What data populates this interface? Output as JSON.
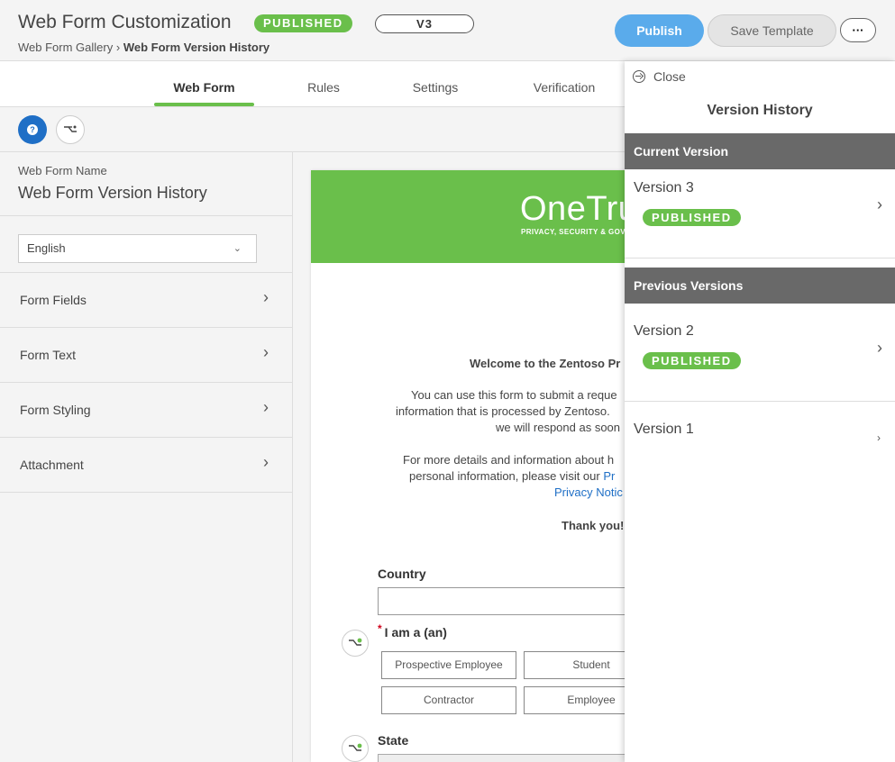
{
  "header": {
    "title": "Web Form Customization",
    "status_badge": "PUBLISHED",
    "version": "V3",
    "breadcrumb_parent": "Web Form Gallery",
    "breadcrumb_sep": "›",
    "breadcrumb_current": "Web Form Version History",
    "publish_label": "Publish",
    "save_template_label": "Save Template",
    "more_label": "···"
  },
  "tabs": [
    {
      "label": "Web Form",
      "active": true
    },
    {
      "label": "Rules"
    },
    {
      "label": "Settings"
    },
    {
      "label": "Verification"
    }
  ],
  "toolbar": {
    "help_icon": "question-icon",
    "logic_icon": "branch-icon",
    "help_glyph": "?"
  },
  "left_panel": {
    "form_name_label": "Web Form Name",
    "form_name_value": "Web Form Version History",
    "language": "English",
    "chevron": "⌄",
    "accordion": [
      {
        "label": "Form Fields"
      },
      {
        "label": "Form Text"
      },
      {
        "label": "Form Styling"
      },
      {
        "label": "Attachment"
      }
    ],
    "accordion_chevron": "›"
  },
  "preview": {
    "brand_logo": "OneTru",
    "brand_tagline": "PRIVACY, SECURITY & GOV",
    "welcome": "Welcome to the Zentoso Pr",
    "para1": [
      "You can use this form to submit a reque",
      "information that is processed by Zentoso.",
      "we will respond as soon"
    ],
    "para2": [
      "For more details and information about h",
      "personal information, please visit our "
    ],
    "para2_link": "Pr",
    "para2_link2": "Privacy Notic",
    "thanks": "Thank you!",
    "country_label": "Country",
    "required_mark": "*",
    "iam_label": "I am a (an)",
    "options": [
      "Prospective Employee",
      "Student",
      "Contractor",
      "Employee"
    ],
    "state_label": "State"
  },
  "version_history": {
    "close_label": "Close",
    "title": "Version History",
    "current_header": "Current Version",
    "previous_header": "Previous Versions",
    "current": [
      {
        "name": "Version 3",
        "badge": "PUBLISHED"
      }
    ],
    "previous": [
      {
        "name": "Version 2",
        "badge": "PUBLISHED"
      },
      {
        "name": "Version 1"
      }
    ],
    "chevron": "›"
  },
  "colors": {
    "accent_green": "#6abf4b",
    "primary_blue": "#5aabeb",
    "help_blue": "#1f6fc6",
    "section_gray": "#696969"
  }
}
